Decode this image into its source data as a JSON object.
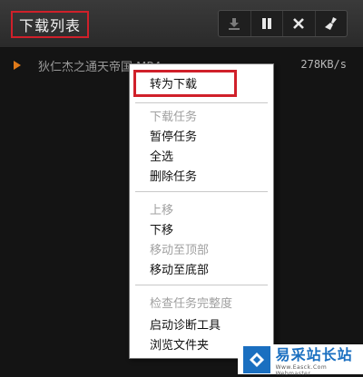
{
  "header": {
    "title": "下载列表",
    "toolbar": {
      "icons": [
        "download-icon",
        "pause-icon",
        "close-icon",
        "broom-icon"
      ]
    }
  },
  "download_list": {
    "items": [
      {
        "name": "狄仁杰之通天帝国.MP4",
        "speed": "278KB/s"
      }
    ]
  },
  "context_menu": {
    "items": [
      {
        "label": "转为下载",
        "enabled": true,
        "highlighted": true
      },
      {
        "label": "下载任务",
        "enabled": false
      },
      {
        "label": "暂停任务",
        "enabled": true
      },
      {
        "label": "全选",
        "enabled": true
      },
      {
        "label": "删除任务",
        "enabled": true
      },
      {
        "label": "上移",
        "enabled": false
      },
      {
        "label": "下移",
        "enabled": true
      },
      {
        "label": "移动至顶部",
        "enabled": false
      },
      {
        "label": "移动至底部",
        "enabled": true
      },
      {
        "label": "检查任务完整度",
        "enabled": false
      },
      {
        "label": "启动诊断工具",
        "enabled": true
      },
      {
        "label": "浏览文件夹",
        "enabled": true
      }
    ]
  },
  "watermark": {
    "text": "易采站长站",
    "subtext": "Www.Easck.Com Webmaster"
  },
  "colors": {
    "highlight_red": "#d0202a",
    "background": "#141414",
    "watermark_blue": "#1a6fc0"
  }
}
